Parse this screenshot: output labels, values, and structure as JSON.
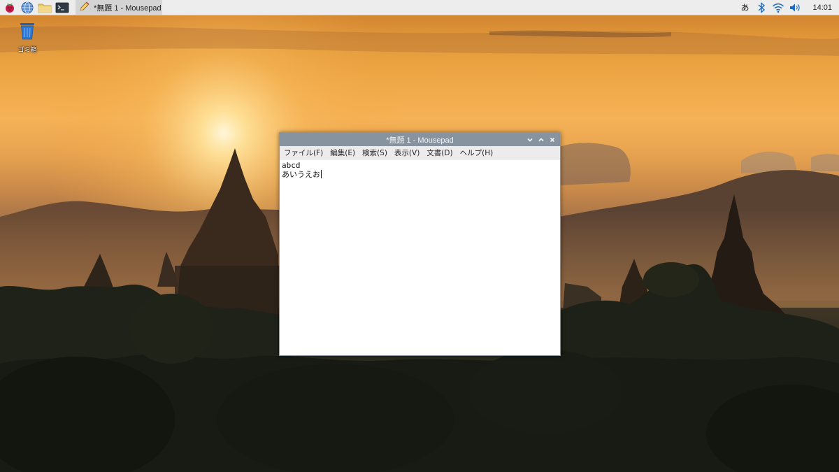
{
  "taskbar": {
    "launchers": [
      {
        "name": "raspberry-menu-icon"
      },
      {
        "name": "web-browser-icon"
      },
      {
        "name": "file-manager-icon"
      },
      {
        "name": "terminal-icon"
      }
    ],
    "task": {
      "icon": "text-editor-icon",
      "label": "*無題 1 - Mousepad"
    },
    "tray": {
      "ime_label": "あ",
      "bluetooth_icon": "bluetooth-icon",
      "wifi_icon": "wifi-icon",
      "volume_icon": "volume-icon"
    },
    "clock": "14:01"
  },
  "desktop": {
    "icons": [
      {
        "label": "ゴミ箱",
        "icon": "trash-icon"
      }
    ]
  },
  "window": {
    "title": "*無題 1 - Mousepad",
    "menu": [
      "ファイル(F)",
      "編集(E)",
      "検索(S)",
      "表示(V)",
      "文書(D)",
      "ヘルプ(H)"
    ],
    "editor_lines": [
      "abcd",
      "あいうえお"
    ]
  }
}
